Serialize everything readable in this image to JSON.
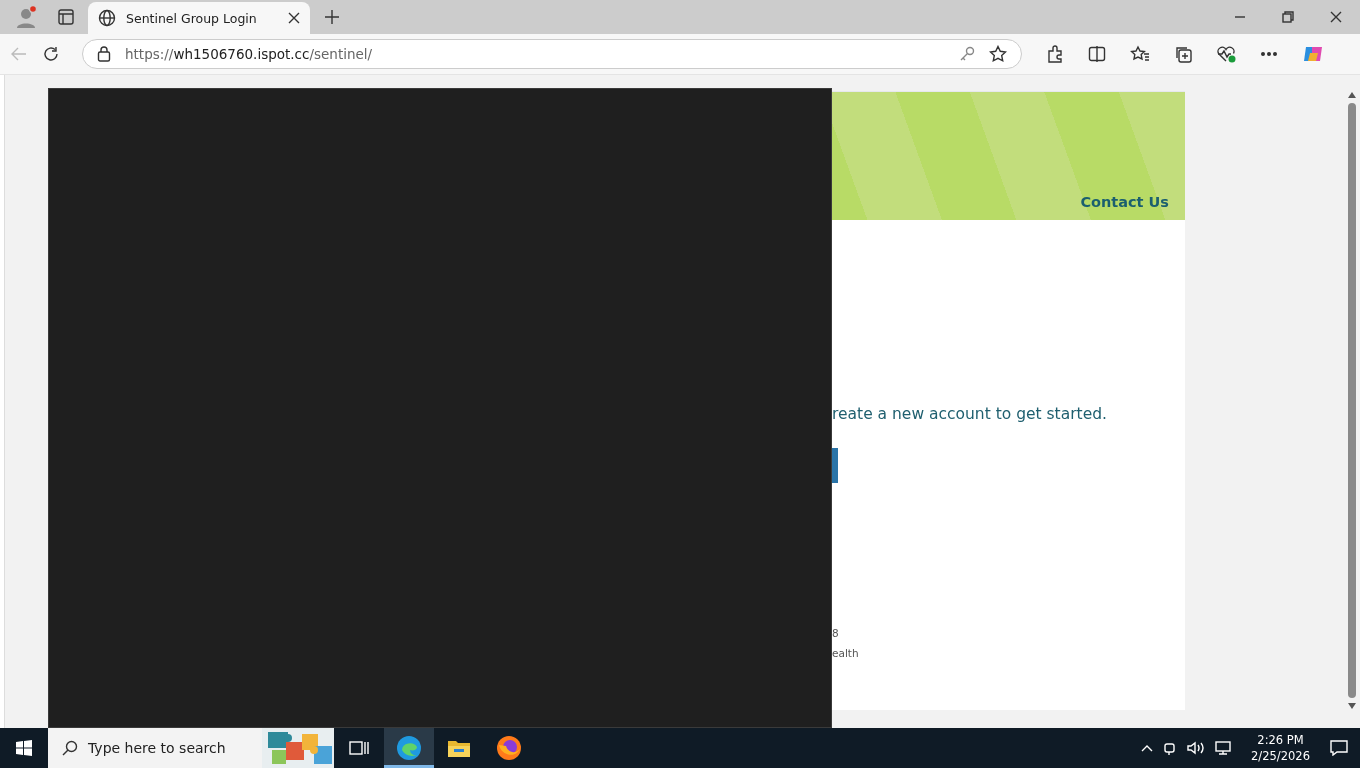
{
  "browser": {
    "tabs": [
      {
        "title": "Sentinel Group Login",
        "selected": true
      }
    ],
    "address": {
      "scheme": "https://",
      "host": "wh1506760.ispot.cc",
      "path": "/sentinel/"
    }
  },
  "page": {
    "contact_link": "Contact Us",
    "intro_text": "reate a new account to get started.",
    "footer_lines": [
      "8",
      "ealth"
    ]
  },
  "taskbar": {
    "search_placeholder": "Type here to search",
    "apps": [
      {
        "kind": "taskview",
        "selected": false
      },
      {
        "kind": "edge",
        "selected": true
      },
      {
        "kind": "explorer",
        "selected": false
      },
      {
        "kind": "firefox",
        "selected": false
      }
    ],
    "time": "2:26 PM",
    "date": "2/25/2026"
  }
}
